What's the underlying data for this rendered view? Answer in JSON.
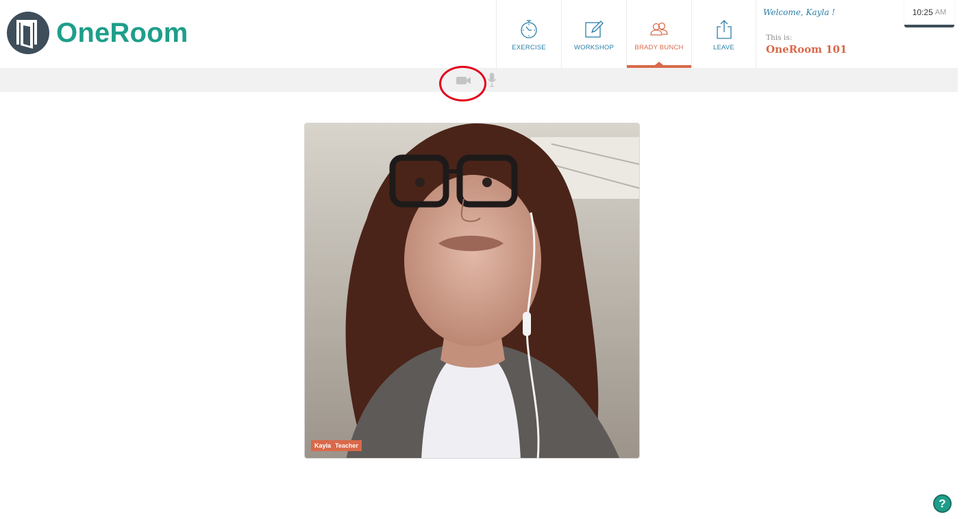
{
  "app": {
    "name": "OneRoom"
  },
  "nav": {
    "items": [
      {
        "label": "EXERCISE",
        "icon": "stopwatch-icon"
      },
      {
        "label": "WORKSHOP",
        "icon": "edit-icon"
      },
      {
        "label": "BRADY BUNCH",
        "icon": "group-icon",
        "active": true
      },
      {
        "label": "LEAVE",
        "icon": "share-exit-icon"
      }
    ]
  },
  "user": {
    "welcome": "Welcome, Kayla !"
  },
  "room": {
    "prefix": "This is:",
    "name": "OneRoom 101"
  },
  "clock": {
    "time": "10:25",
    "ampm": "AM"
  },
  "toolbar": {
    "camera_icon": "video-camera-icon",
    "mic_icon": "microphone-icon"
  },
  "video": {
    "participant_name": "Kayla",
    "participant_role": "Teacher"
  },
  "help": {
    "label": "?"
  },
  "colors": {
    "brand": "#1e9e8a",
    "accent": "#d9694a",
    "nav_text": "#2a7fa8",
    "toolbar_bg": "#f1f1f2",
    "highlight": "#e4001b"
  }
}
